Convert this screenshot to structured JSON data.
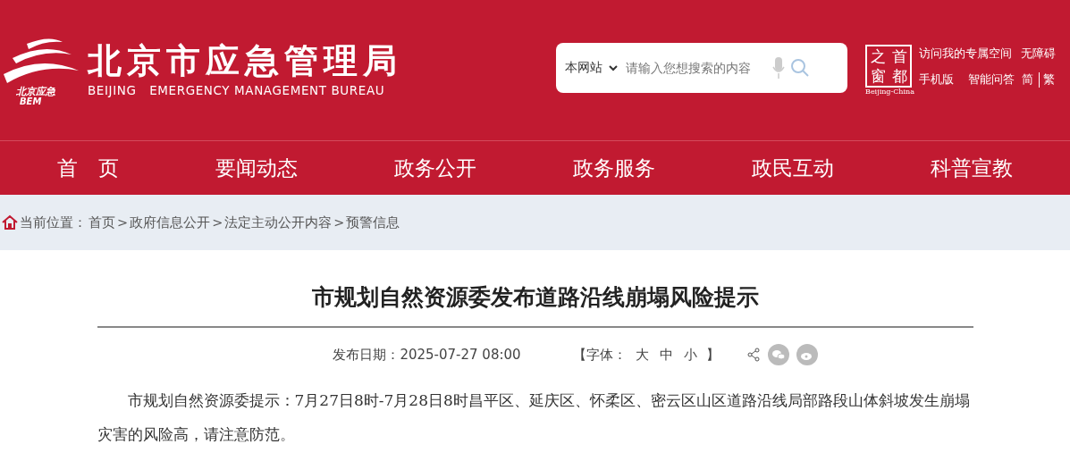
{
  "header": {
    "logo_mark": {
      "line1": "北京应急",
      "line2": "BEM"
    },
    "title": "北京市应急管理局",
    "subtitle": "BEIJING   EMERGENCY MANAGEMENT BUREAU"
  },
  "search": {
    "scope": "本网站",
    "placeholder": "请输入您想搜索的内容"
  },
  "portal_badge": {
    "chars": [
      "之",
      "首",
      "窗",
      "都"
    ],
    "caption": "Beijing-China"
  },
  "top_links": [
    {
      "label": "访问我的专属空间"
    },
    {
      "label": "无障碍"
    },
    {
      "label": "手机版"
    },
    {
      "label": "智能问答"
    },
    {
      "label": "简"
    },
    {
      "label": "繁"
    }
  ],
  "nav": [
    {
      "label": "首　页",
      "selected": false
    },
    {
      "label": "要闻动态",
      "selected": false
    },
    {
      "label": "政务公开",
      "selected": false
    },
    {
      "label": "政务服务",
      "selected": false
    },
    {
      "label": "政民互动",
      "selected": false
    },
    {
      "label": "科普宣教",
      "selected": false
    }
  ],
  "breadcrumb": {
    "label": "当前位置：",
    "separator": ">",
    "items": [
      "首页",
      "政府信息公开",
      "法定主动公开内容",
      "预警信息"
    ]
  },
  "article": {
    "title": "市规划自然资源委发布道路沿线崩塌风险提示",
    "date": "发布日期：2025-07-27 08:00",
    "font_size": {
      "open": "【字体：",
      "sizes": [
        "大",
        "中",
        "小"
      ],
      "close": "】"
    },
    "body": "市规划自然资源委提示：7月27日8时-7月28日8时昌平区、延庆区、怀柔区、密云区山区道路沿线局部路段山体斜坡发生崩塌灾害的风险高，请注意防范。"
  }
}
